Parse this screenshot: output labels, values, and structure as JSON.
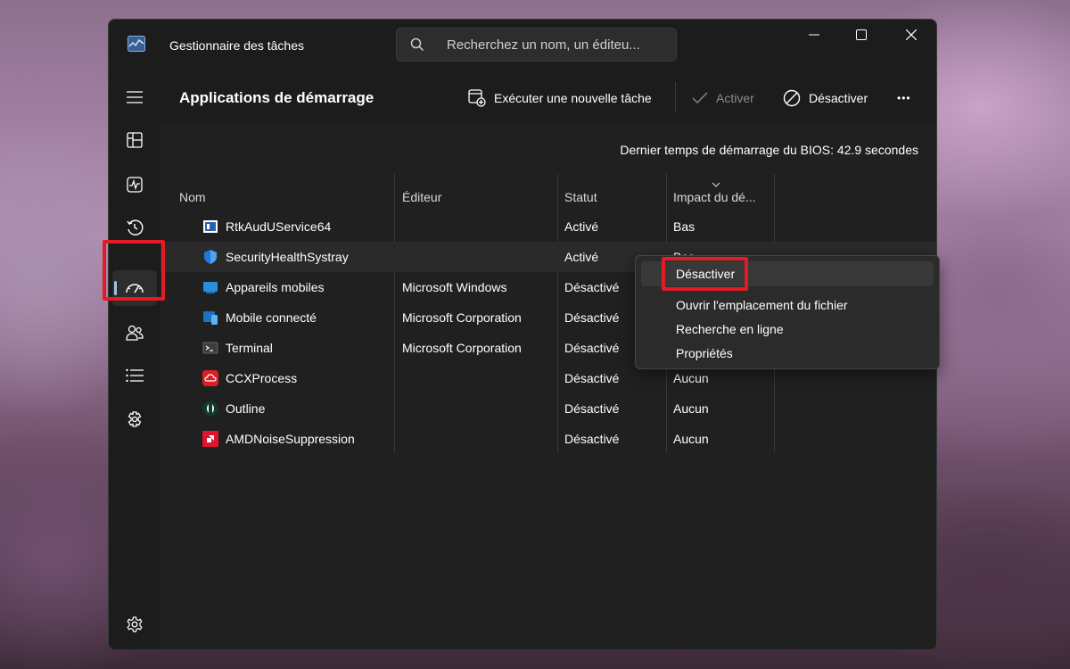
{
  "window": {
    "title": "Gestionnaire des tâches",
    "search": {
      "placeholder": "Recherchez un nom, un éditeu..."
    }
  },
  "sidebar": {
    "items": [
      {
        "name": "menu-icon"
      },
      {
        "name": "processes-icon"
      },
      {
        "name": "performance-icon"
      },
      {
        "name": "app-history-icon"
      },
      {
        "name": "startup-apps-icon",
        "active": true
      },
      {
        "name": "users-icon"
      },
      {
        "name": "details-icon"
      },
      {
        "name": "services-icon"
      },
      {
        "name": "settings-icon"
      }
    ]
  },
  "header": {
    "title": "Applications de démarrage",
    "run_task": "Exécuter une nouvelle tâche",
    "enable": "Activer",
    "disable": "Désactiver",
    "more": "•••"
  },
  "bios_text": "Dernier temps de démarrage du BIOS: 42.9 secondes",
  "table": {
    "columns": [
      "Nom",
      "Éditeur",
      "Statut",
      "Impact du dé..."
    ],
    "rows": [
      {
        "name": "RtkAudUService64",
        "publisher": "",
        "status": "Activé",
        "impact": "Bas",
        "icon": "realtek-icon"
      },
      {
        "name": "SecurityHealthSystray",
        "publisher": "",
        "status": "Activé",
        "impact": "Bas",
        "icon": "shield-icon"
      },
      {
        "name": "Appareils mobiles",
        "publisher": "Microsoft Windows",
        "status": "Désactivé",
        "impact": "",
        "icon": "mobile-devices-icon"
      },
      {
        "name": "Mobile connecté",
        "publisher": "Microsoft Corporation",
        "status": "Désactivé",
        "impact": "",
        "icon": "phone-link-icon"
      },
      {
        "name": "Terminal",
        "publisher": "Microsoft Corporation",
        "status": "Désactivé",
        "impact": "",
        "icon": "terminal-icon"
      },
      {
        "name": "CCXProcess",
        "publisher": "",
        "status": "Désactivé",
        "impact": "Aucun",
        "icon": "creative-cloud-icon"
      },
      {
        "name": "Outline",
        "publisher": "",
        "status": "Désactivé",
        "impact": "Aucun",
        "icon": "outline-icon"
      },
      {
        "name": "AMDNoiseSuppression",
        "publisher": "",
        "status": "Désactivé",
        "impact": "Aucun",
        "icon": "amd-icon"
      }
    ]
  },
  "context_menu": {
    "items": [
      "Désactiver",
      "Ouvrir l'emplacement du fichier",
      "Recherche en ligne",
      "Propriétés"
    ]
  },
  "colors": {
    "highlight": "#e21b24",
    "accent": "#9fc2ea",
    "window_bg": "#1c1c1c",
    "content_bg": "#202020"
  }
}
